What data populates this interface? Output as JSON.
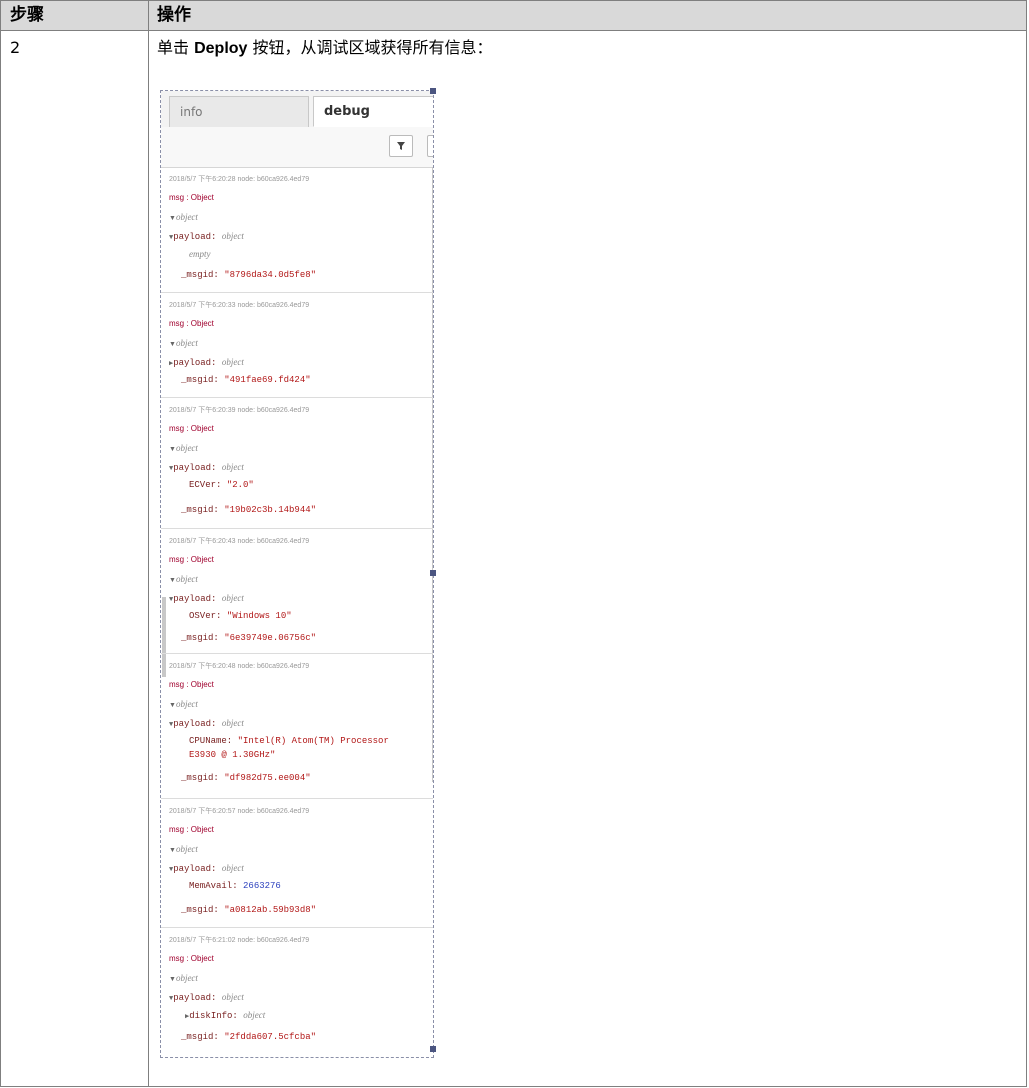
{
  "table": {
    "header": {
      "step": "步骤",
      "action": "操作"
    },
    "row": {
      "step": "2",
      "action_prefix": "单击 ",
      "action_bold": "Deploy",
      "action_suffix": " 按钮，从调试区域获得所有信息："
    }
  },
  "debug_panel": {
    "tabs": [
      {
        "label": "info"
      },
      {
        "label": "debug"
      }
    ],
    "filter_icon": "filter-icon",
    "messages": [
      {
        "meta": "2018/5/7 下午6:20:28   node: b60ca926.4ed79",
        "topic": "msg : Object",
        "object": "object",
        "payload_key": "payload:",
        "payload_type": "object",
        "lines": [
          {
            "text": "empty"
          }
        ],
        "msgid": "\"8796da34.0d5fe8\""
      },
      {
        "meta": "2018/5/7 下午6:20:33   node: b60ca926.4ed79",
        "topic": "msg : Object",
        "object": "object",
        "payload_key": "payload:",
        "payload_type": "object",
        "msgid": "\"491fae69.fd424\""
      },
      {
        "meta": "2018/5/7 下午6:20:39   node: b60ca926.4ed79",
        "topic": "msg : Object",
        "object": "object",
        "payload_key": "payload:",
        "payload_type": "object",
        "lines": [
          {
            "key": "ECVer:",
            "value": "\"2.0\""
          }
        ],
        "msgid": "\"19b02c3b.14b944\""
      },
      {
        "meta": "2018/5/7 下午6:20:43   node: b60ca926.4ed79",
        "topic": "msg : Object",
        "object": "object",
        "payload_key": "payload:",
        "payload_type": "object",
        "lines": [
          {
            "key": "OSVer:",
            "value": "\"Windows 10\""
          }
        ],
        "msgid": "\"6e39749e.06756c\""
      },
      {
        "meta": "2018/5/7 下午6:20:48   node: b60ca926.4ed79",
        "topic": "msg : Object",
        "object": "object",
        "payload_key": "payload:",
        "payload_type": "object",
        "lines": [
          {
            "key": "CPUName:",
            "value": "\"Intel(R) Atom(TM) Processor",
            "cont": "E3930 @ 1.30GHz\""
          }
        ],
        "msgid": "\"df982d75.ee004\""
      },
      {
        "meta": "2018/5/7 下午6:20:57   node: b60ca926.4ed79",
        "topic": "msg : Object",
        "object": "object",
        "payload_key": "payload:",
        "payload_type": "object",
        "lines": [
          {
            "key": "MemAvail:",
            "number": "2663276"
          }
        ],
        "msgid": "\"a0812ab.59b93d8\""
      },
      {
        "meta": "2018/5/7 下午6:21:02   node: b60ca926.4ed79",
        "topic": "msg : Object",
        "object": "object",
        "payload_key": "payload:",
        "payload_type": "object",
        "lines": [
          {
            "key": "diskInfo:",
            "type": "object"
          }
        ],
        "msgid": "\"2fdda607.5cfcba\""
      }
    ]
  }
}
